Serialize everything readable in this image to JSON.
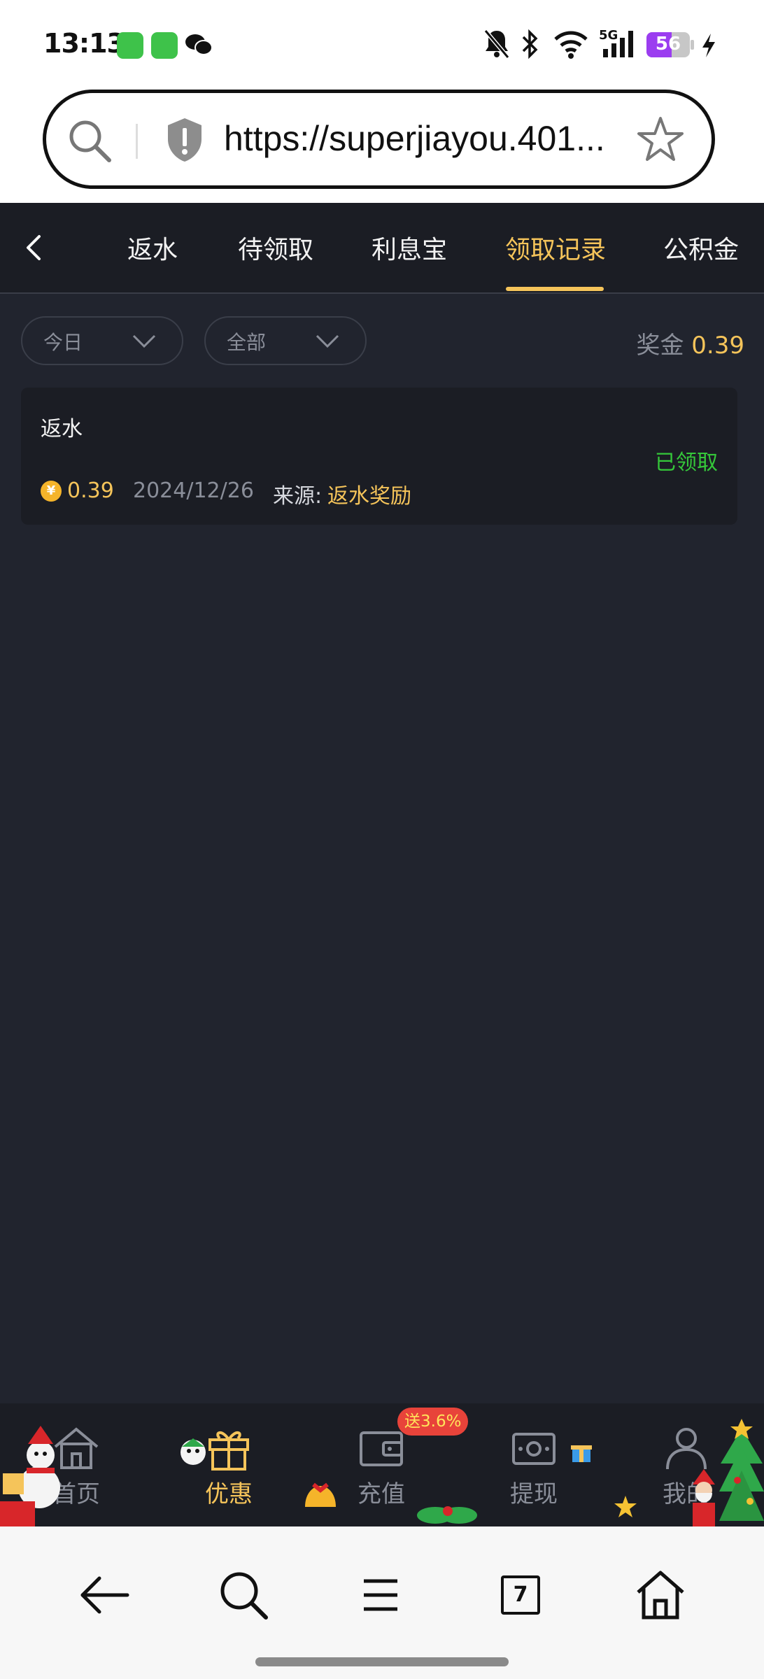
{
  "status_bar": {
    "time": "13:13",
    "network": "5G",
    "battery_level": "56",
    "icons": [
      "mute-bell-icon",
      "bluetooth-icon",
      "wifi-icon",
      "signal-icon",
      "battery-icon",
      "charging-icon"
    ]
  },
  "browser": {
    "url": "https://superjiayou.401...",
    "tab_count": "7"
  },
  "tabs": [
    {
      "label": "返水",
      "active": false
    },
    {
      "label": "待领取",
      "active": false
    },
    {
      "label": "利息宝",
      "active": false
    },
    {
      "label": "领取记录",
      "active": true
    },
    {
      "label": "公积金",
      "active": false
    }
  ],
  "filters": {
    "date": "今日",
    "type": "全部",
    "bonus_label": "奖金",
    "bonus_value": "0.39"
  },
  "records": [
    {
      "title": "返水",
      "status": "已领取",
      "currency_symbol": "¥",
      "amount": "0.39",
      "date": "2024/12/26",
      "source_label": "来源:",
      "source": "返水奖励"
    }
  ],
  "bottom_nav": {
    "promo_badge": "送3.6%",
    "items": [
      {
        "label": "首页",
        "icon": "home-icon",
        "active": false
      },
      {
        "label": "优惠",
        "icon": "gift-icon",
        "active": true
      },
      {
        "label": "充值",
        "icon": "wallet-icon",
        "active": false
      },
      {
        "label": "提现",
        "icon": "cash-icon",
        "active": false
      },
      {
        "label": "我的",
        "icon": "user-icon",
        "active": false
      }
    ]
  },
  "colors": {
    "background": "#21242e",
    "panel": "#1b1d24",
    "accent": "#f5c45a",
    "success": "#35c83a",
    "muted": "#8a8e99"
  }
}
